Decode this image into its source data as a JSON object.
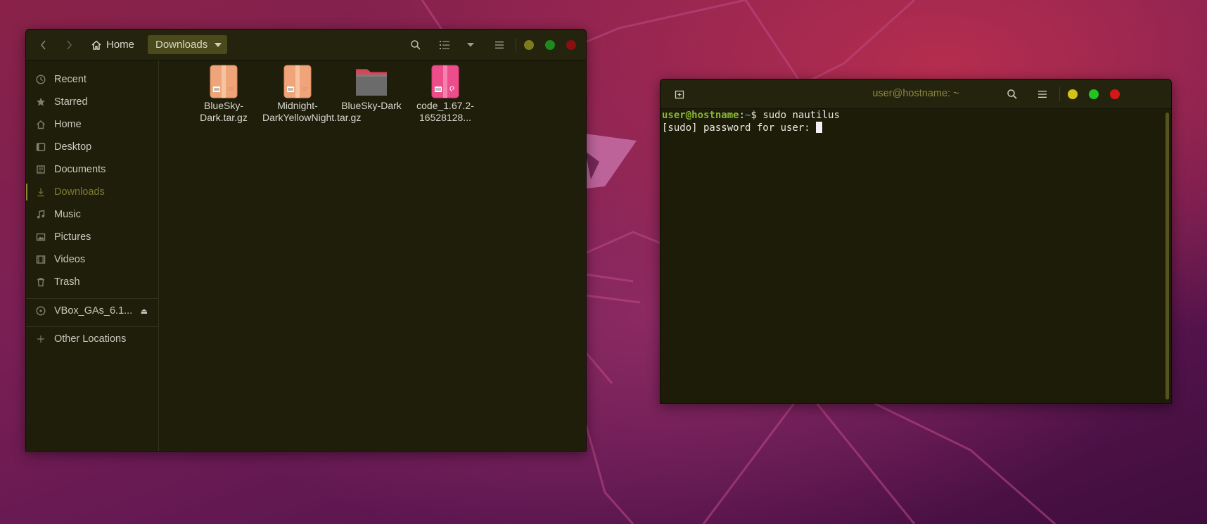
{
  "desktop": {
    "wallpaper": "Ubuntu 20.04 Focal Fossa",
    "accent": "#8a8735"
  },
  "nautilus": {
    "breadcrumb": {
      "home_label": "Home",
      "current_label": "Downloads"
    },
    "toolbar_icons": [
      "search-icon",
      "list-view-icon",
      "sort-chevron-icon",
      "hamburger-menu-icon"
    ],
    "window_buttons": {
      "minimize_color": "#7e7a1e",
      "maximize_color": "#1c8a1c",
      "close_color": "#8a1010"
    },
    "sidebar": [
      {
        "label": "Recent",
        "icon": "clock-icon"
      },
      {
        "label": "Starred",
        "icon": "star-icon"
      },
      {
        "label": "Home",
        "icon": "home-icon"
      },
      {
        "label": "Desktop",
        "icon": "desktop-icon"
      },
      {
        "label": "Documents",
        "icon": "document-icon"
      },
      {
        "label": "Downloads",
        "icon": "download-icon",
        "active": true
      },
      {
        "label": "Music",
        "icon": "music-icon"
      },
      {
        "label": "Pictures",
        "icon": "picture-icon"
      },
      {
        "label": "Videos",
        "icon": "video-icon"
      },
      {
        "label": "Trash",
        "icon": "trash-icon"
      }
    ],
    "devices": [
      {
        "label": "VBox_GAs_6.1...",
        "icon": "disc-icon",
        "eject_icon": "eject-icon"
      }
    ],
    "other_locations": {
      "label": "Other Locations",
      "icon": "plus-icon"
    },
    "files": [
      {
        "name": "BlueSky-Dark.tar.gz",
        "type": "archive"
      },
      {
        "name": "Midnight-DarkYellowNight.tar.gz",
        "type": "archive"
      },
      {
        "name": "BlueSky-Dark",
        "type": "folder"
      },
      {
        "name": "code_1.67.2-16528128...",
        "type": "deb-package"
      }
    ]
  },
  "terminal": {
    "title": "user@hostname: ~",
    "prompt_user": "user@hostname",
    "prompt_sep": ":",
    "prompt_path": "~",
    "prompt_symbol": "$ ",
    "command": "sudo nautilus",
    "output_line": "[sudo] password for user: ",
    "window_buttons": {
      "minimize_color": "#d4c11a",
      "maximize_color": "#22c422",
      "close_color": "#d41818"
    }
  }
}
